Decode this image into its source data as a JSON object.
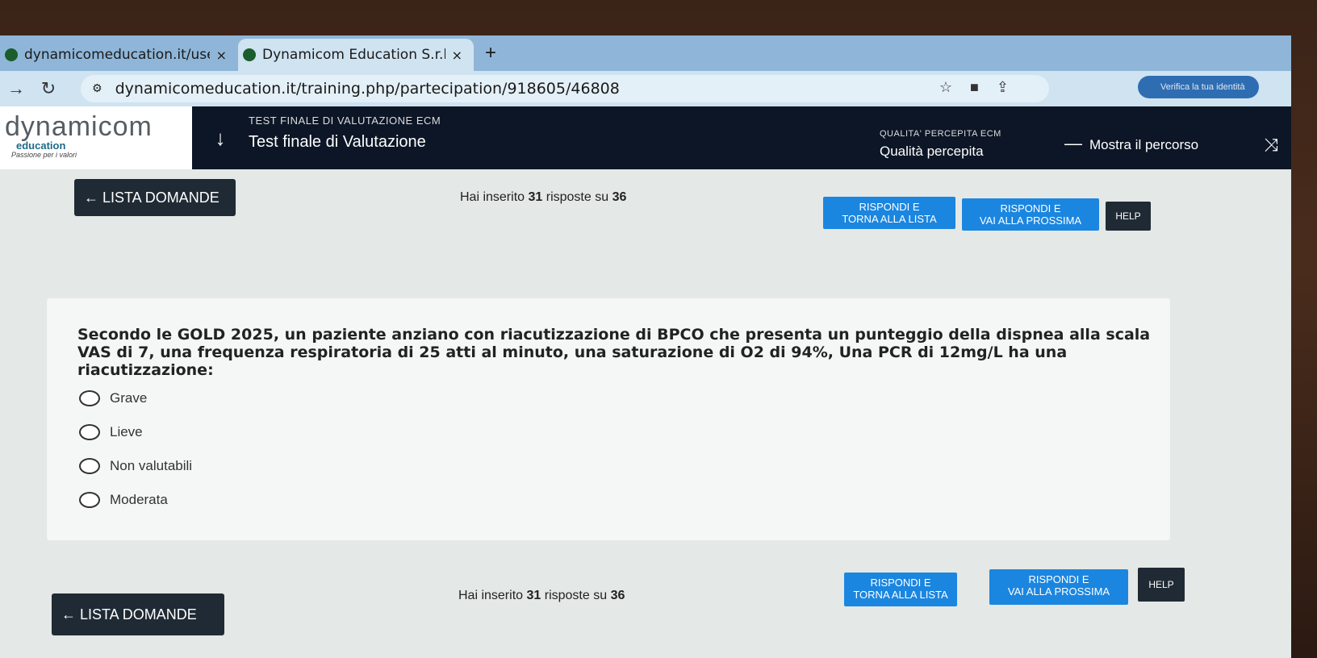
{
  "browser": {
    "tabs": [
      {
        "title": "dynamicomeducation.it/user/da",
        "active": false
      },
      {
        "title": "Dynamicom Education S.r.l.",
        "active": true
      }
    ],
    "tab_close": "×",
    "new_tab": "+",
    "url": "dynamicomeducation.it/training.php/partecipation/918605/46808",
    "verify_label": "Verifica la tua identità"
  },
  "header": {
    "logo_main": "dynamicom",
    "logo_sub": "education",
    "logo_tag": "Passione per i valori",
    "course_small": "TEST FINALE DI VALUTAZIONE ECM",
    "course_big": "Test finale di Valutazione",
    "quality_small": "QUALITA' PERCEPITA ECM",
    "quality_big": "Qualità percepita",
    "path_label": "Mostra il percorso"
  },
  "nav": {
    "list_label": "← LISTA DOMANDE",
    "progress_prefix": "Hai inserito",
    "answered": "31",
    "progress_middle": "risposte su",
    "total": "36",
    "answer_list_l1": "RISPONDI E",
    "answer_list_l2": "TORNA ALLA LISTA",
    "answer_next_l1": "RISPONDI E",
    "answer_next_l2": "VAI ALLA PROSSIMA",
    "help": "HELP"
  },
  "question": {
    "text": "Secondo le GOLD 2025, un paziente anziano con riacutizzazione di BPCO che presenta un punteggio della dispnea alla scala VAS di 7, una frequenza respiratoria di 25 atti al minuto, una saturazione di O2 di 94%, Una PCR di 12mg/L ha una riacutizzazione:",
    "options": [
      "Grave",
      "Lieve",
      "Non valutabili",
      "Moderata"
    ]
  }
}
